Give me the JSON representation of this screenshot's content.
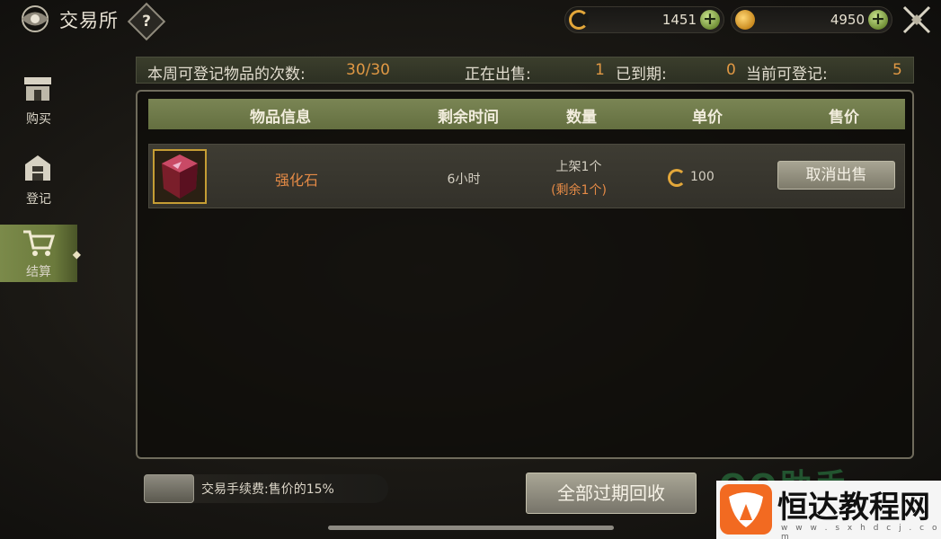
{
  "header": {
    "title": "交易所",
    "help_label": "?"
  },
  "currencies": [
    {
      "icon": "c-coin-icon",
      "value": "1451"
    },
    {
      "icon": "gold-coin-icon",
      "value": "4950"
    }
  ],
  "sidebar": {
    "items": [
      {
        "label": "购买",
        "icon": "shop-icon",
        "active": false
      },
      {
        "label": "登记",
        "icon": "register-icon",
        "active": false
      },
      {
        "label": "结算",
        "icon": "cart-icon",
        "active": true
      }
    ]
  },
  "info_bar": {
    "weekly_label": "本周可登记物品的次数:",
    "weekly_value": "30/30",
    "selling_label": "正在出售:",
    "selling_value": "1",
    "expired_label": "已到期:",
    "expired_value": "0",
    "available_label": "当前可登记:",
    "available_value": "5"
  },
  "table": {
    "headers": [
      "物品信息",
      "剩余时间",
      "数量",
      "单价",
      "售价"
    ],
    "rows": [
      {
        "item_name": "强化石",
        "time_left": "6小时",
        "qty_listed": "上架1个",
        "qty_remaining": "(剩余1个)",
        "unit_price": "100",
        "action_label": "取消出售"
      }
    ]
  },
  "footer": {
    "fee_text": "交易手续费:售价的15%",
    "recycle_label": "全部过期回收"
  },
  "watermark": {
    "back_text": "QQ助手",
    "title": "恒达教程网",
    "url": "w w w . s x h d c j . c o m"
  },
  "colors": {
    "accent_orange": "#e09844",
    "header_green": "#7a8554",
    "coin_gold": "#e3a73a"
  }
}
